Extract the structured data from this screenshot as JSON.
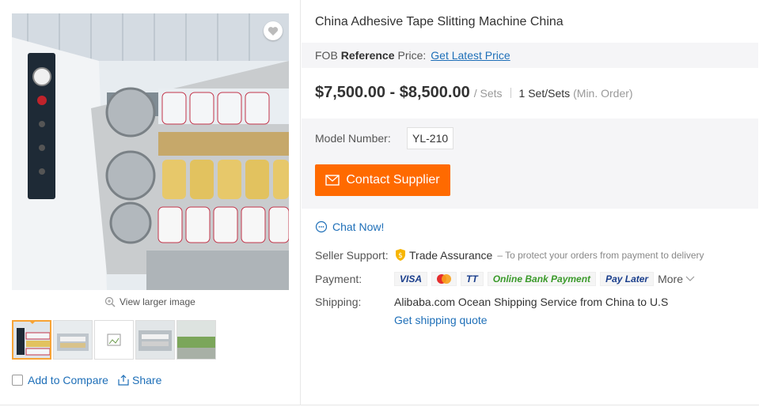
{
  "product": {
    "title": "China Adhesive Tape Slitting Machine China"
  },
  "fob": {
    "prefix": "FOB",
    "bold": "Reference",
    "suffix": "Price:",
    "link": "Get Latest Price"
  },
  "price": {
    "range": "$7,500.00 - $8,500.00",
    "unit": "/ Sets",
    "moq": "1 Set/Sets",
    "moq_note": "(Min. Order)"
  },
  "model": {
    "label": "Model Number:",
    "value": "YL-210"
  },
  "actions": {
    "contact": "Contact Supplier",
    "chat": "Chat Now!"
  },
  "gallery": {
    "view_larger": "View larger image",
    "add_to_compare": "Add to Compare",
    "share": "Share"
  },
  "seller_support": {
    "label": "Seller Support:",
    "trade_assurance": "Trade Assurance",
    "note": "– To protect your orders from payment to delivery"
  },
  "payment": {
    "label": "Payment:",
    "methods": [
      "VISA",
      "TT",
      "Online Bank Payment",
      "Pay Later"
    ],
    "more": "More"
  },
  "shipping": {
    "label": "Shipping:",
    "service": "Alibaba.com Ocean Shipping Service from China to U.S",
    "quote": "Get shipping quote"
  },
  "colors": {
    "accent": "#ff6a00",
    "link": "#1e6fb8",
    "thumb_active": "#f7a335"
  }
}
